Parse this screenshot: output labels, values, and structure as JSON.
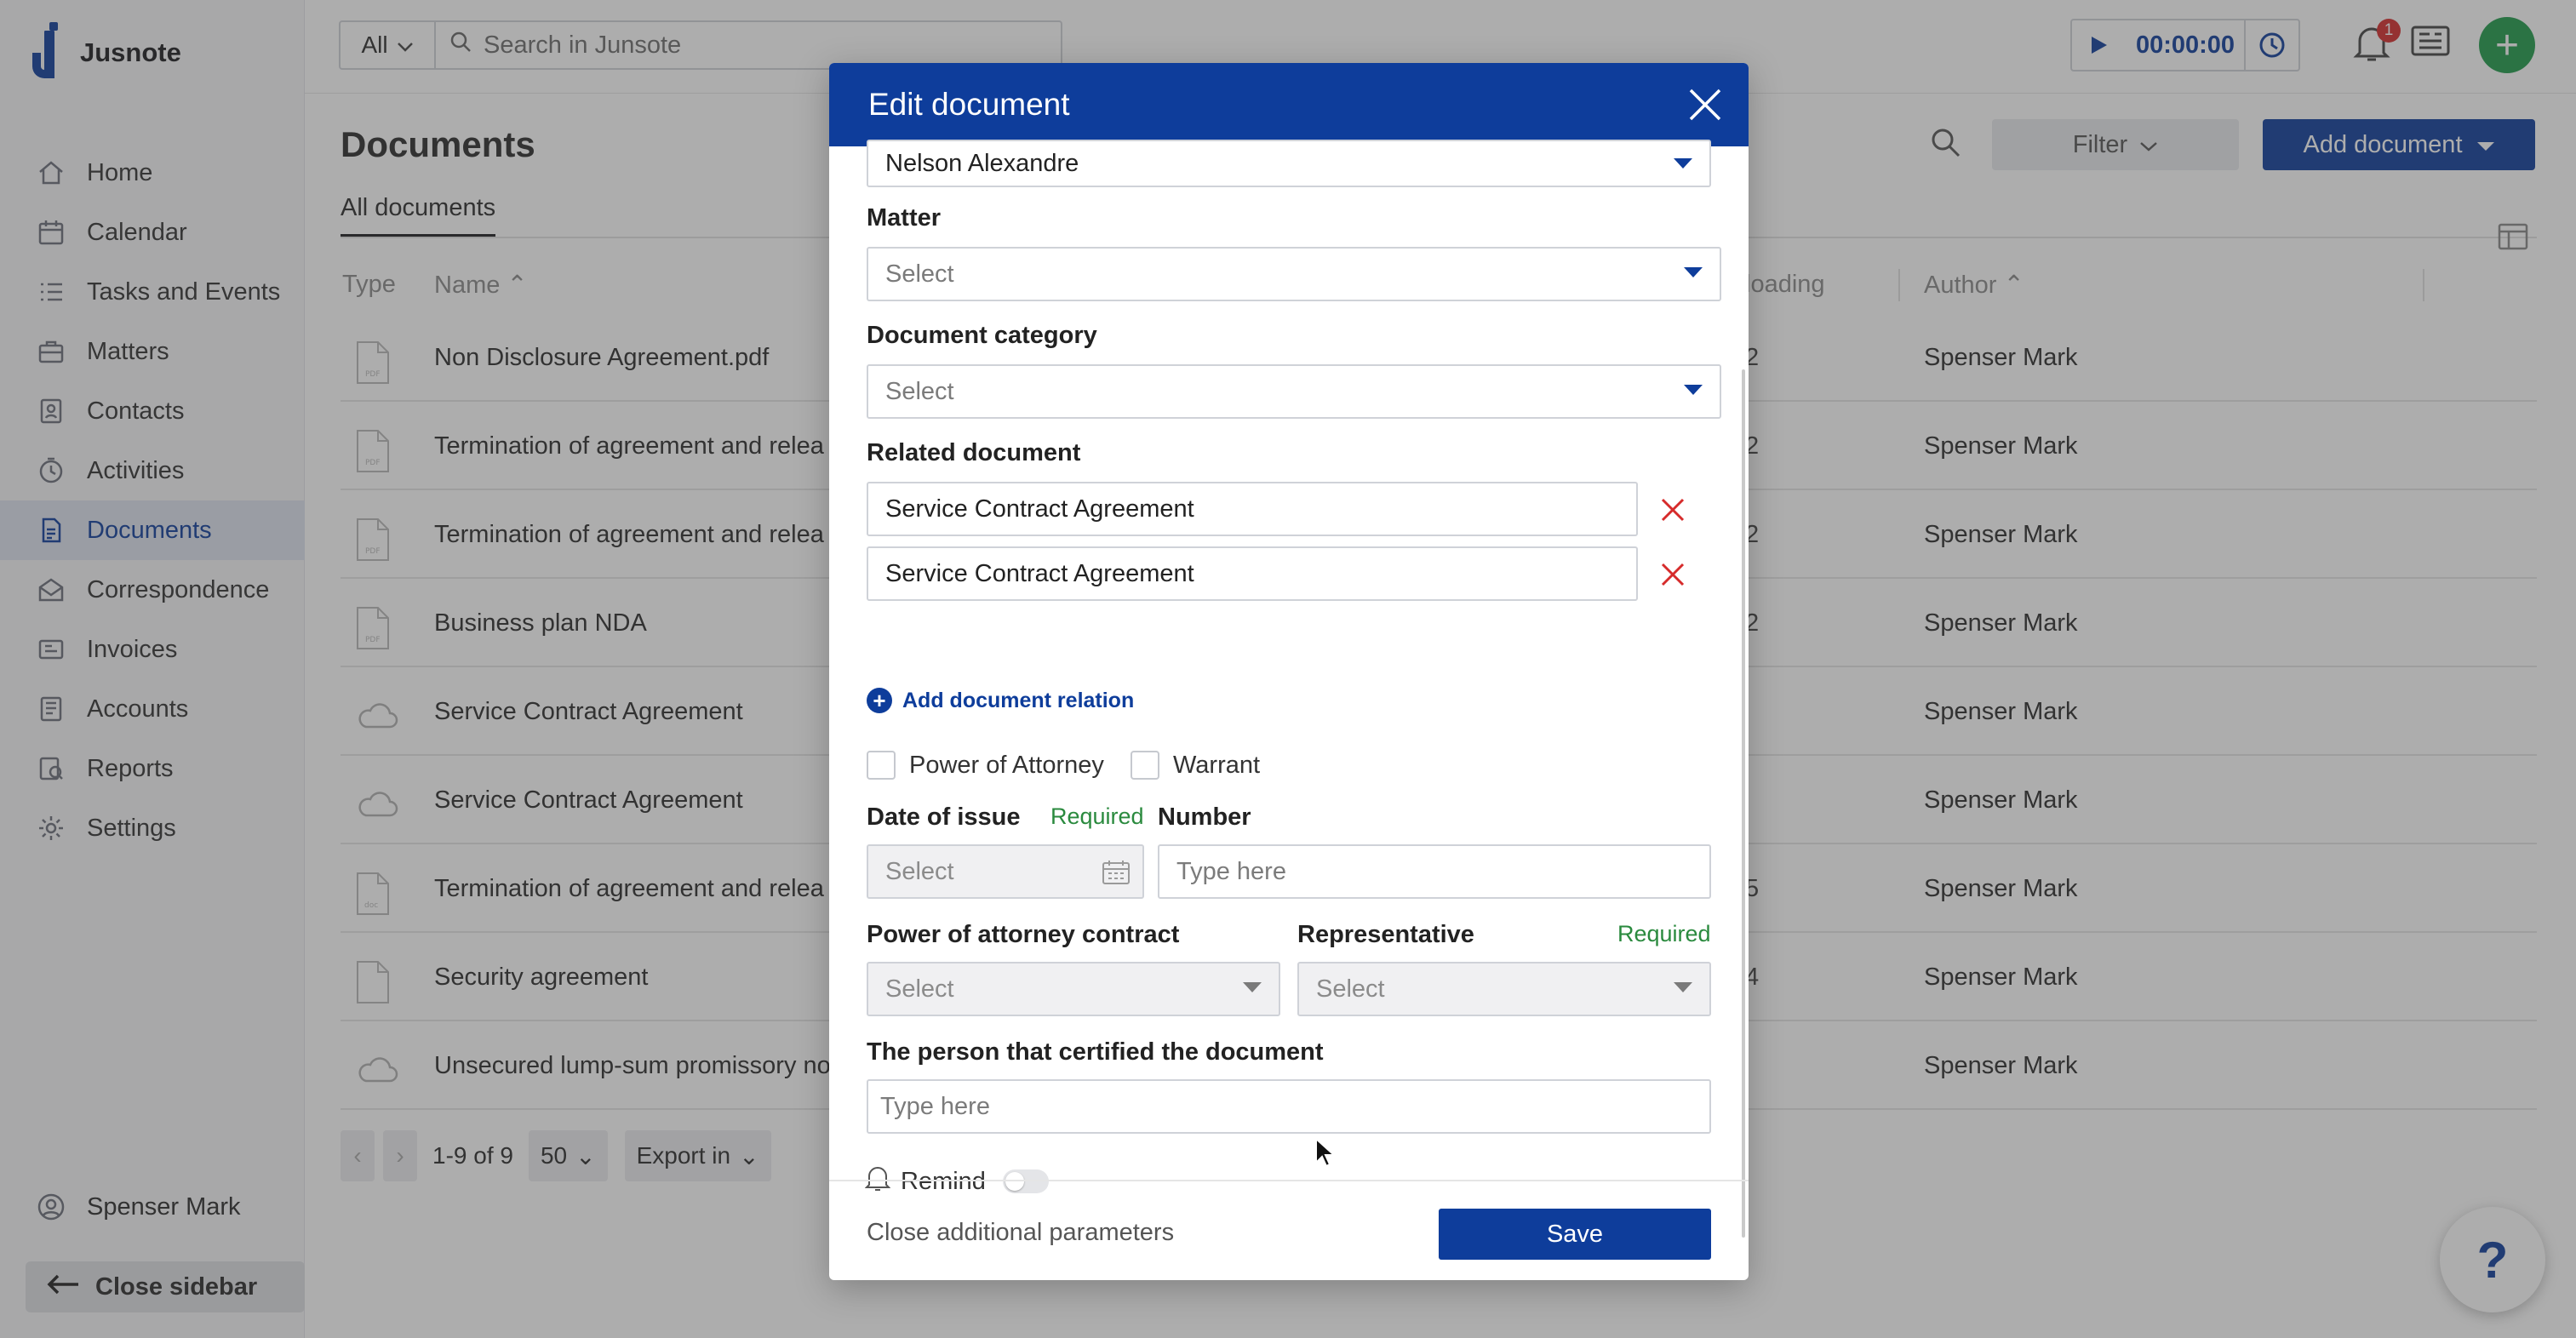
{
  "app": {
    "name": "Jusnote"
  },
  "sidebar": {
    "items": [
      {
        "label": "Home",
        "icon": "home-icon"
      },
      {
        "label": "Calendar",
        "icon": "calendar-icon"
      },
      {
        "label": "Tasks and Events",
        "icon": "tasks-icon"
      },
      {
        "label": "Matters",
        "icon": "matters-icon"
      },
      {
        "label": "Contacts",
        "icon": "contacts-icon"
      },
      {
        "label": "Activities",
        "icon": "activities-icon"
      },
      {
        "label": "Documents",
        "icon": "documents-icon",
        "active": true
      },
      {
        "label": "Correspondence",
        "icon": "correspondence-icon"
      },
      {
        "label": "Invoices",
        "icon": "invoices-icon"
      },
      {
        "label": "Accounts",
        "icon": "accounts-icon"
      },
      {
        "label": "Reports",
        "icon": "reports-icon"
      },
      {
        "label": "Settings",
        "icon": "settings-icon"
      }
    ],
    "user": "Spenser Mark",
    "close_label": "Close sidebar"
  },
  "topbar": {
    "scope": "All",
    "search_placeholder": "Search in Junsote",
    "timer": "00:00:00",
    "notifications": "1"
  },
  "page": {
    "title": "Documents",
    "tab": "All documents",
    "filter_label": "Filter",
    "add_label": "Add document"
  },
  "table": {
    "headers": {
      "type": "Type",
      "name": "Name",
      "loading": "loading",
      "author": "Author"
    },
    "rows": [
      {
        "name": "Non Disclosure Agreement.pdf",
        "loading": "2",
        "author": "Spenser Mark",
        "icon": "pdf"
      },
      {
        "name": "Termination of agreement and relea",
        "loading": "2",
        "author": "Spenser Mark",
        "icon": "pdf"
      },
      {
        "name": "Termination of agreement and relea",
        "loading": "2",
        "author": "Spenser Mark",
        "icon": "pdf"
      },
      {
        "name": "Business plan NDA",
        "loading": "2",
        "author": "Spenser Mark",
        "icon": "pdf"
      },
      {
        "name": "Service Contract Agreement",
        "loading": "",
        "author": "Spenser Mark",
        "icon": "cloud"
      },
      {
        "name": "Service Contract Agreement",
        "loading": "",
        "author": "Spenser Mark",
        "icon": "cloud"
      },
      {
        "name": "Termination of agreement and relea",
        "loading": "5",
        "author": "Spenser Mark",
        "icon": "doc"
      },
      {
        "name": "Security agreement",
        "loading": "4",
        "author": "Spenser Mark",
        "icon": "file"
      },
      {
        "name": "Unsecured lump-sum promissory no",
        "loading": "",
        "author": "Spenser Mark",
        "icon": "cloud"
      }
    ]
  },
  "pager": {
    "range": "1-9 of 9",
    "per_page": "50",
    "export": "Export in"
  },
  "modal": {
    "title": "Edit document",
    "client_value": "Nelson Alexandre",
    "matter_label": "Matter",
    "matter_placeholder": "Select",
    "category_label": "Document category",
    "category_placeholder": "Select",
    "related_label": "Related document",
    "related": [
      "Service Contract Agreement",
      "Service Contract Agreement"
    ],
    "add_relation": "Add document relation",
    "checkbox_poa": "Power of Attorney",
    "checkbox_warrant": "Warrant",
    "date_label": "Date of issue",
    "required": "Required",
    "date_placeholder": "Select",
    "number_label": "Number",
    "number_placeholder": "Type here",
    "poa_contract_label": "Power of attorney contract",
    "poa_contract_placeholder": "Select",
    "representative_label": "Representative",
    "representative_placeholder": "Select",
    "certified_label": "The person that certified the document",
    "certified_placeholder": "Type here",
    "remind_label": "Remind",
    "close_params": "Close additional parameters",
    "save": "Save"
  },
  "help": "?",
  "colors": {
    "brand": "#0e3d9b",
    "required": "#2a8a3e",
    "delete": "#d62b2b",
    "add": "#1f9b4b"
  }
}
